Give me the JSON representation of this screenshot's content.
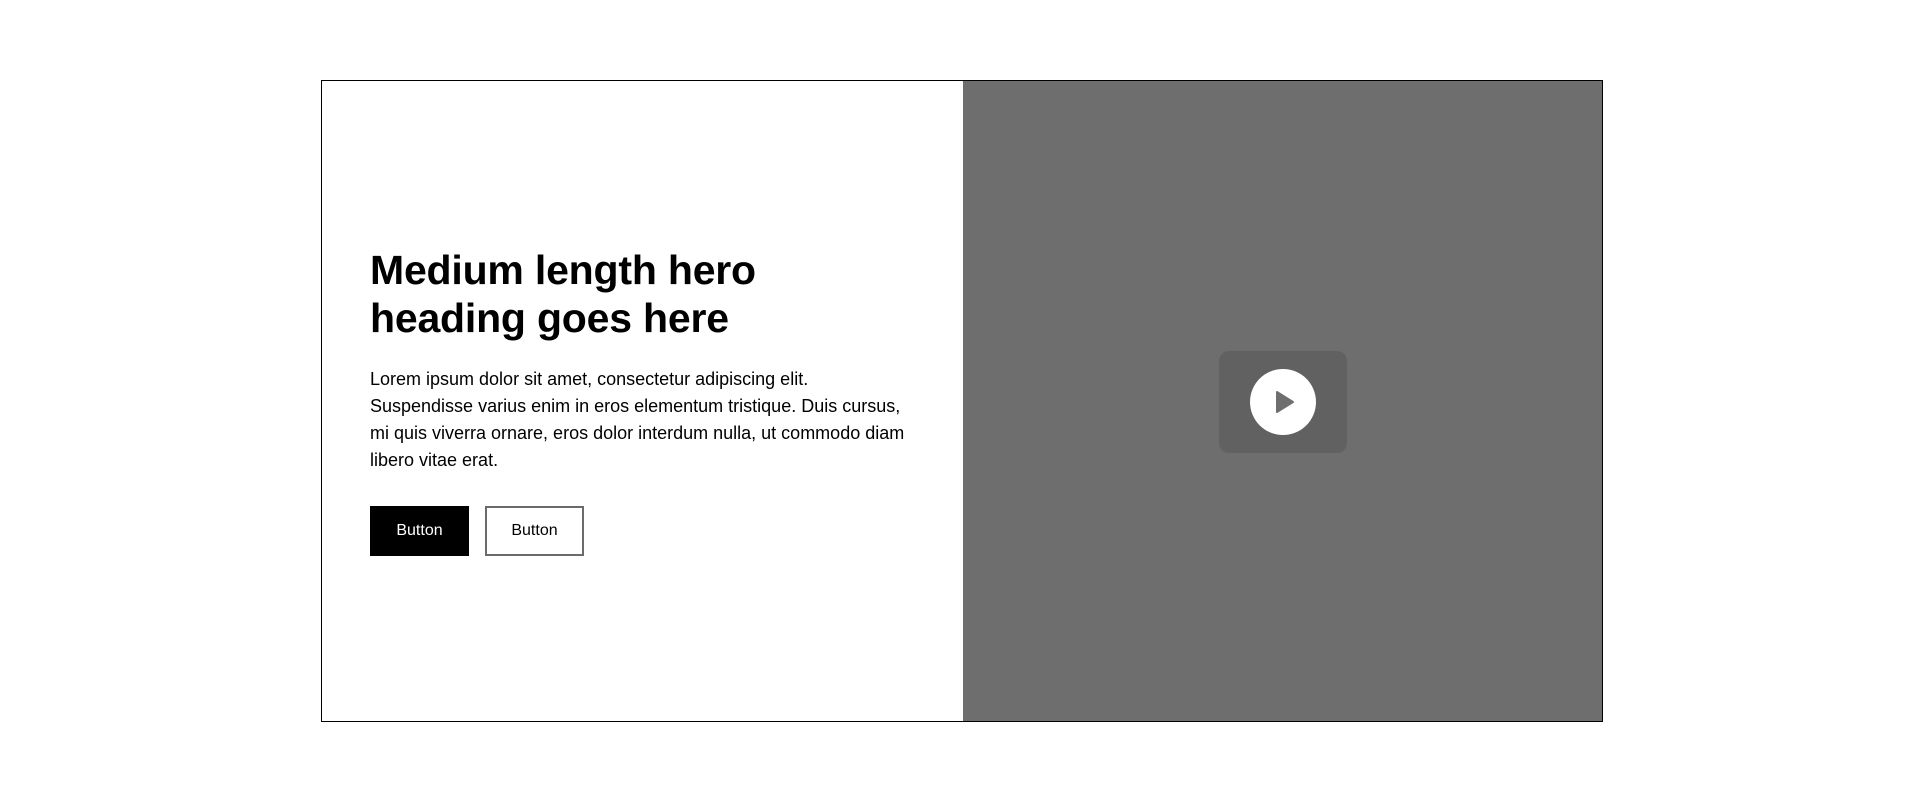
{
  "hero": {
    "title": "Medium length hero heading goes here",
    "body": "Lorem ipsum dolor sit amet, consectetur adipiscing elit. Suspendisse varius enim in eros elementum tristique. Duis cursus, mi quis viverra ornare, eros dolor interdum nulla, ut commodo diam libero vitae erat.",
    "primary_button_label": "Button",
    "secondary_button_label": "Button"
  },
  "media": {
    "icon": "play-icon"
  },
  "colors": {
    "background": "#ffffff",
    "text": "#000000",
    "media_background": "#6e6e6e",
    "play_tile": "#616161",
    "play_circle": "#ffffff",
    "play_triangle": "#6e6e6e"
  }
}
